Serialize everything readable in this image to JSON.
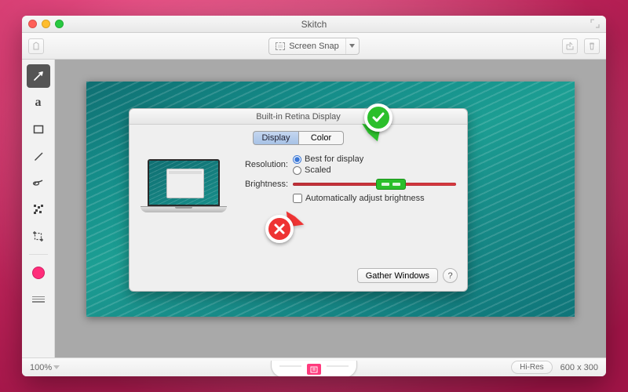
{
  "window": {
    "title": "Skitch",
    "toolbar": {
      "snap_label": "Screen Snap"
    }
  },
  "dialog": {
    "title": "Built-in Retina Display",
    "tabs": {
      "display": "Display",
      "color": "Color"
    },
    "resolution_label": "Resolution:",
    "resolution_options": {
      "best": "Best for display",
      "scaled": "Scaled"
    },
    "brightness_label": "Brightness:",
    "auto_brightness": "Automatically adjust brightness",
    "gather": "Gather Windows",
    "help": "?"
  },
  "status": {
    "zoom": "100%",
    "hires": "Hi-Res",
    "dimensions": "600 x 300"
  },
  "tools": {
    "arrow": "arrow",
    "text": "text",
    "rect": "shape-rect",
    "pen": "pen",
    "highlight": "highlighter",
    "pixelate": "pixelate",
    "crop": "crop",
    "color": "color",
    "line": "line-width"
  }
}
